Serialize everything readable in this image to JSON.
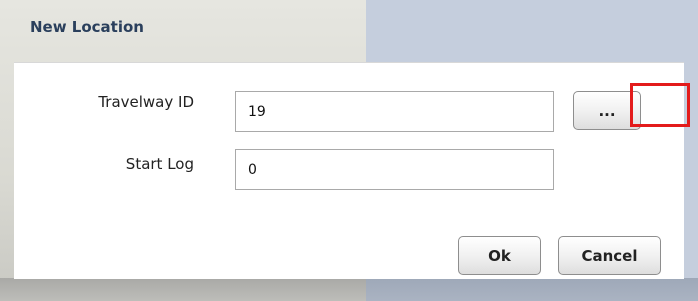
{
  "dialog": {
    "title": "New Location",
    "fields": {
      "travelway": {
        "label": "Travelway ID",
        "value": "19"
      },
      "start_log": {
        "label": "Start Log",
        "value": "0"
      }
    },
    "buttons": {
      "browse": "...",
      "ok": "Ok",
      "cancel": "Cancel"
    }
  },
  "colors": {
    "title": "#2a3f5c",
    "highlight": "#e31b1b",
    "right_background": "#c5cedd"
  }
}
